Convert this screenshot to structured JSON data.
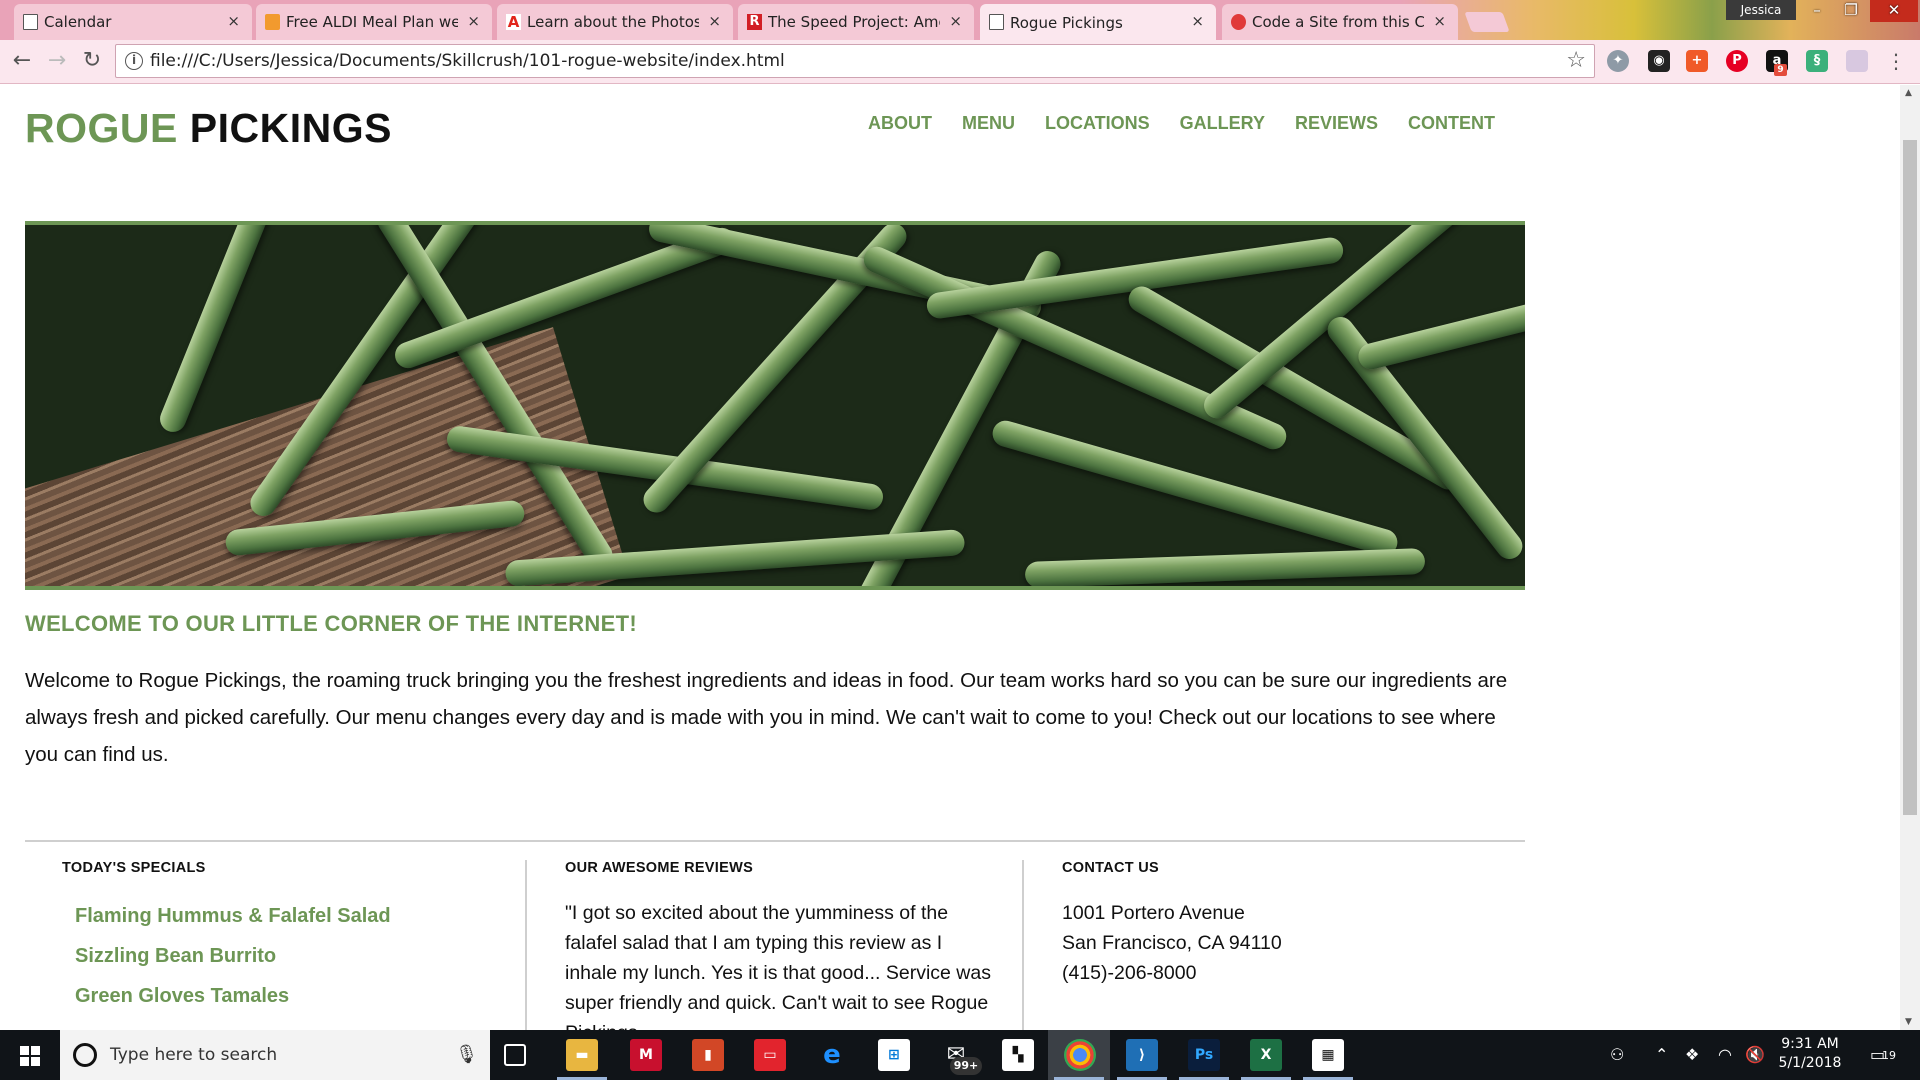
{
  "browser": {
    "tabs": [
      {
        "title": "Calendar",
        "favicon": "document-icon"
      },
      {
        "title": "Free ALDI Meal Plan wee",
        "favicon": "aldi-icon"
      },
      {
        "title": "Learn about the Photosh",
        "favicon": "adobe-icon"
      },
      {
        "title": "The Speed Project: Amer",
        "favicon": "r-icon"
      },
      {
        "title": "Rogue Pickings",
        "favicon": "document-icon",
        "active": true
      },
      {
        "title": "Code a Site from this Cor",
        "favicon": "code-icon"
      }
    ],
    "close_glyph": "×",
    "user": "Jessica",
    "url": "file:///C:/Users/Jessica/Documents/Skillcrush/101-rogue-website/index.html",
    "accent": "#e9a3b8",
    "extension_badge": "9"
  },
  "site": {
    "brand_green": "ROGUE",
    "brand_black": "PICKINGS",
    "nav": [
      "ABOUT",
      "MENU",
      "LOCATIONS",
      "GALLERY",
      "REVIEWS",
      "CONTENT"
    ],
    "welcome_heading": "WELCOME TO OUR LITTLE CORNER OF THE INTERNET!",
    "intro": "Welcome to Rogue Pickings, the roaming truck bringing you the freshest ingredients and ideas in food. Our team works hard so you can be sure our ingredients are always fresh and picked carefully. Our menu changes every day and is made with you in mind. We can't wait to come to you! Check out our locations to see where you can find us.",
    "specials_heading": "TODAY'S SPECIALS",
    "specials": [
      "Flaming Hummus & Falafel Salad",
      "Sizzling Bean Burrito",
      "Green Gloves Tamales"
    ],
    "reviews_heading": "OUR AWESOME REVIEWS",
    "review_text": "\"I got so excited about the yumminess of the falafel salad that I am typing this review as I inhale my lunch. Yes it is that good... Service was super friendly and quick. Can't wait to see Rogue Pickings",
    "contact_heading": "CONTACT US",
    "contact": [
      "1001 Portero Avenue",
      "San Francisco, CA 94110",
      "(415)-206-8000"
    ],
    "green": "#6d9655"
  },
  "taskbar": {
    "search_placeholder": "Type here to search",
    "mail_badge": "99+",
    "time": "9:31 AM",
    "date": "5/1/2018",
    "notification_count": "19"
  }
}
